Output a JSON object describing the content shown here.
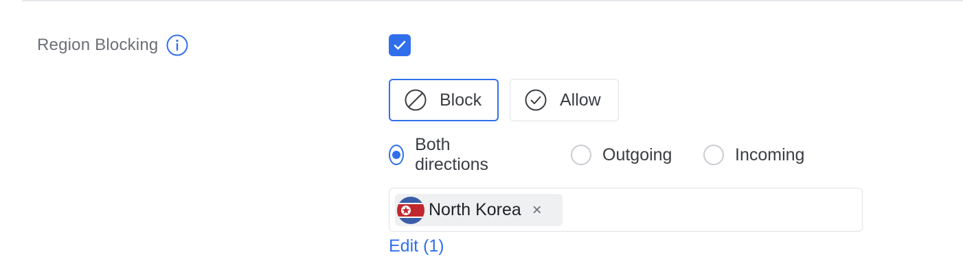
{
  "setting": {
    "label": "Region Blocking",
    "enabled": true
  },
  "mode": {
    "block_label": "Block",
    "allow_label": "Allow",
    "selected": "Block"
  },
  "direction": {
    "options": [
      "Both directions",
      "Outgoing",
      "Incoming"
    ],
    "selected": "Both directions"
  },
  "regions": {
    "chips": [
      {
        "label": "North Korea",
        "remove_symbol": "×",
        "flag_icon": "north-korea-flag-icon"
      }
    ]
  },
  "edit": {
    "label": "Edit (1)"
  },
  "colors": {
    "accent": "#2f6fec",
    "label_text": "#6b6f75",
    "body_text": "#3a3d42",
    "border": "#dfe2e6",
    "chip_bg": "#eef0f2"
  }
}
